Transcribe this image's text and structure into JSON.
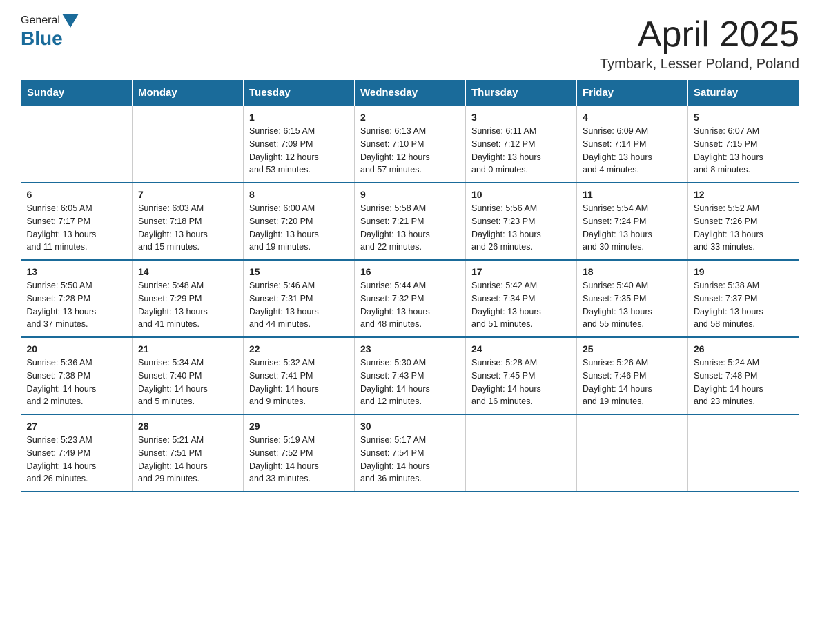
{
  "header": {
    "logo_general": "General",
    "logo_blue": "Blue",
    "month_title": "April 2025",
    "location": "Tymbark, Lesser Poland, Poland"
  },
  "calendar": {
    "days_of_week": [
      "Sunday",
      "Monday",
      "Tuesday",
      "Wednesday",
      "Thursday",
      "Friday",
      "Saturday"
    ],
    "weeks": [
      [
        {
          "day": "",
          "info": ""
        },
        {
          "day": "",
          "info": ""
        },
        {
          "day": "1",
          "info": "Sunrise: 6:15 AM\nSunset: 7:09 PM\nDaylight: 12 hours\nand 53 minutes."
        },
        {
          "day": "2",
          "info": "Sunrise: 6:13 AM\nSunset: 7:10 PM\nDaylight: 12 hours\nand 57 minutes."
        },
        {
          "day": "3",
          "info": "Sunrise: 6:11 AM\nSunset: 7:12 PM\nDaylight: 13 hours\nand 0 minutes."
        },
        {
          "day": "4",
          "info": "Sunrise: 6:09 AM\nSunset: 7:14 PM\nDaylight: 13 hours\nand 4 minutes."
        },
        {
          "day": "5",
          "info": "Sunrise: 6:07 AM\nSunset: 7:15 PM\nDaylight: 13 hours\nand 8 minutes."
        }
      ],
      [
        {
          "day": "6",
          "info": "Sunrise: 6:05 AM\nSunset: 7:17 PM\nDaylight: 13 hours\nand 11 minutes."
        },
        {
          "day": "7",
          "info": "Sunrise: 6:03 AM\nSunset: 7:18 PM\nDaylight: 13 hours\nand 15 minutes."
        },
        {
          "day": "8",
          "info": "Sunrise: 6:00 AM\nSunset: 7:20 PM\nDaylight: 13 hours\nand 19 minutes."
        },
        {
          "day": "9",
          "info": "Sunrise: 5:58 AM\nSunset: 7:21 PM\nDaylight: 13 hours\nand 22 minutes."
        },
        {
          "day": "10",
          "info": "Sunrise: 5:56 AM\nSunset: 7:23 PM\nDaylight: 13 hours\nand 26 minutes."
        },
        {
          "day": "11",
          "info": "Sunrise: 5:54 AM\nSunset: 7:24 PM\nDaylight: 13 hours\nand 30 minutes."
        },
        {
          "day": "12",
          "info": "Sunrise: 5:52 AM\nSunset: 7:26 PM\nDaylight: 13 hours\nand 33 minutes."
        }
      ],
      [
        {
          "day": "13",
          "info": "Sunrise: 5:50 AM\nSunset: 7:28 PM\nDaylight: 13 hours\nand 37 minutes."
        },
        {
          "day": "14",
          "info": "Sunrise: 5:48 AM\nSunset: 7:29 PM\nDaylight: 13 hours\nand 41 minutes."
        },
        {
          "day": "15",
          "info": "Sunrise: 5:46 AM\nSunset: 7:31 PM\nDaylight: 13 hours\nand 44 minutes."
        },
        {
          "day": "16",
          "info": "Sunrise: 5:44 AM\nSunset: 7:32 PM\nDaylight: 13 hours\nand 48 minutes."
        },
        {
          "day": "17",
          "info": "Sunrise: 5:42 AM\nSunset: 7:34 PM\nDaylight: 13 hours\nand 51 minutes."
        },
        {
          "day": "18",
          "info": "Sunrise: 5:40 AM\nSunset: 7:35 PM\nDaylight: 13 hours\nand 55 minutes."
        },
        {
          "day": "19",
          "info": "Sunrise: 5:38 AM\nSunset: 7:37 PM\nDaylight: 13 hours\nand 58 minutes."
        }
      ],
      [
        {
          "day": "20",
          "info": "Sunrise: 5:36 AM\nSunset: 7:38 PM\nDaylight: 14 hours\nand 2 minutes."
        },
        {
          "day": "21",
          "info": "Sunrise: 5:34 AM\nSunset: 7:40 PM\nDaylight: 14 hours\nand 5 minutes."
        },
        {
          "day": "22",
          "info": "Sunrise: 5:32 AM\nSunset: 7:41 PM\nDaylight: 14 hours\nand 9 minutes."
        },
        {
          "day": "23",
          "info": "Sunrise: 5:30 AM\nSunset: 7:43 PM\nDaylight: 14 hours\nand 12 minutes."
        },
        {
          "day": "24",
          "info": "Sunrise: 5:28 AM\nSunset: 7:45 PM\nDaylight: 14 hours\nand 16 minutes."
        },
        {
          "day": "25",
          "info": "Sunrise: 5:26 AM\nSunset: 7:46 PM\nDaylight: 14 hours\nand 19 minutes."
        },
        {
          "day": "26",
          "info": "Sunrise: 5:24 AM\nSunset: 7:48 PM\nDaylight: 14 hours\nand 23 minutes."
        }
      ],
      [
        {
          "day": "27",
          "info": "Sunrise: 5:23 AM\nSunset: 7:49 PM\nDaylight: 14 hours\nand 26 minutes."
        },
        {
          "day": "28",
          "info": "Sunrise: 5:21 AM\nSunset: 7:51 PM\nDaylight: 14 hours\nand 29 minutes."
        },
        {
          "day": "29",
          "info": "Sunrise: 5:19 AM\nSunset: 7:52 PM\nDaylight: 14 hours\nand 33 minutes."
        },
        {
          "day": "30",
          "info": "Sunrise: 5:17 AM\nSunset: 7:54 PM\nDaylight: 14 hours\nand 36 minutes."
        },
        {
          "day": "",
          "info": ""
        },
        {
          "day": "",
          "info": ""
        },
        {
          "day": "",
          "info": ""
        }
      ]
    ]
  }
}
